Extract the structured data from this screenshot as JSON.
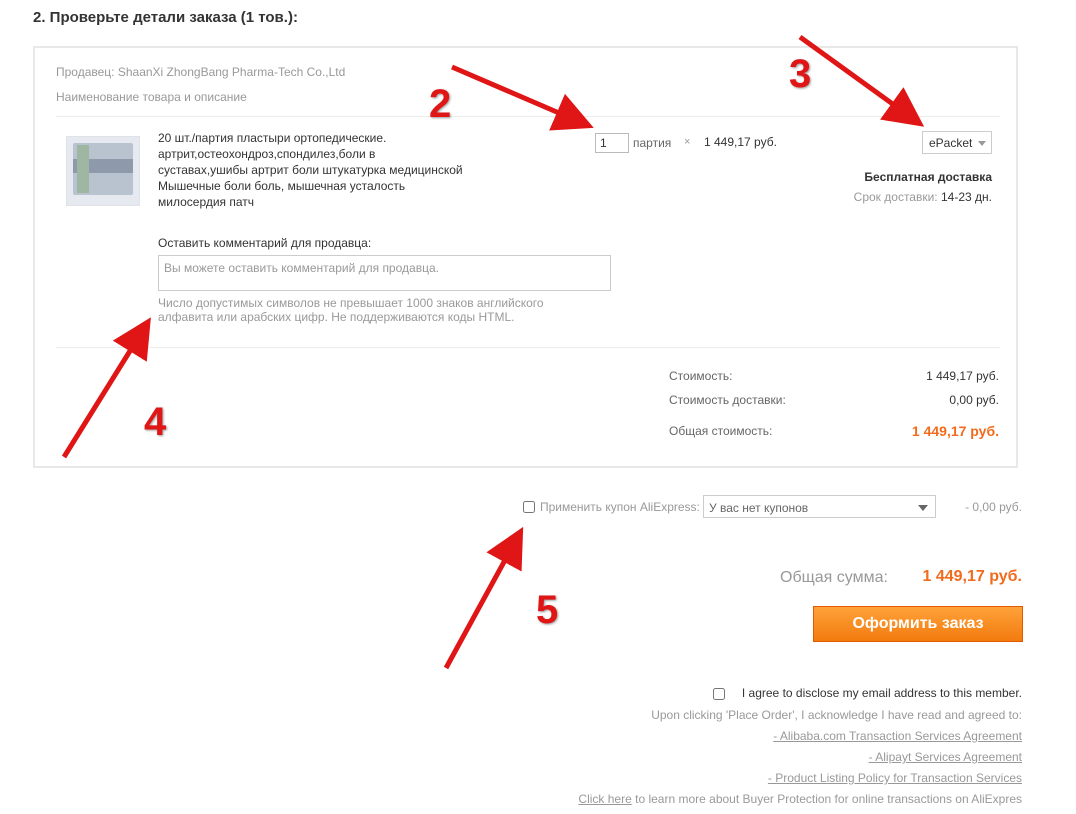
{
  "section_title": "2. Проверьте детали заказа (1 тов.):",
  "seller": "Продавец: ShaanXi ZhongBang Pharma-Tech Co.,Ltd",
  "items_header": "Наименование товара и описание",
  "product": {
    "title": "20 шт./партия пластыри ортопедические. артрит,остеохондроз,спондилез,боли в суставах,ушибы артрит боли штукатурка медицинской Мышечные боли боль, мышечная усталость милосердия патч",
    "quantity": "1",
    "unit": "партия",
    "times": "×",
    "price": "1 449,17 руб."
  },
  "shipping": {
    "method": "ePacket",
    "free_label": "Бесплатная доставка",
    "time_label": "Срок доставки:",
    "time_value": "14-23 дн."
  },
  "comment": {
    "label": "Оставить комментарий для продавца:",
    "placeholder": "Вы можете оставить комментарий для продавца.",
    "hint": "Число допустимых символов не превышает 1000 знаков английского алфавита или арабских цифр. Не поддерживаются коды HTML."
  },
  "summary": {
    "cost_label": "Стоимость:",
    "cost_value": "1 449,17 руб.",
    "shipping_label": "Стоимость доставки:",
    "shipping_value": "0,00 руб.",
    "total_label": "Общая стоимость:",
    "total_value": "1 449,17 руб."
  },
  "coupon": {
    "label": "Применить купон AliExpress:",
    "selected": "У вас нет купонов",
    "discount": "- 0,00 руб."
  },
  "grand_total": {
    "label": "Общая сумма:",
    "value": "1 449,17 руб."
  },
  "order_button": "Оформить заказ",
  "agreement": {
    "checkbox_label": "I agree to disclose my email address to this member.",
    "notice": "Upon clicking 'Place Order', I acknowledge I have read and agreed to:",
    "links": [
      "- Alibaba.com Transaction Services Agreement",
      "- Alipayt Services Agreement",
      "- Product Listing Policy for Transaction Services"
    ],
    "protection_link": "Click here",
    "protection_text": " to learn more about Buyer Protection for online transactions on AliExpres"
  },
  "annotations": [
    "2",
    "3",
    "4",
    "5"
  ],
  "colors": {
    "accent": "#f26b1d",
    "annotation": "#e01515",
    "button": "#f27b0f"
  }
}
